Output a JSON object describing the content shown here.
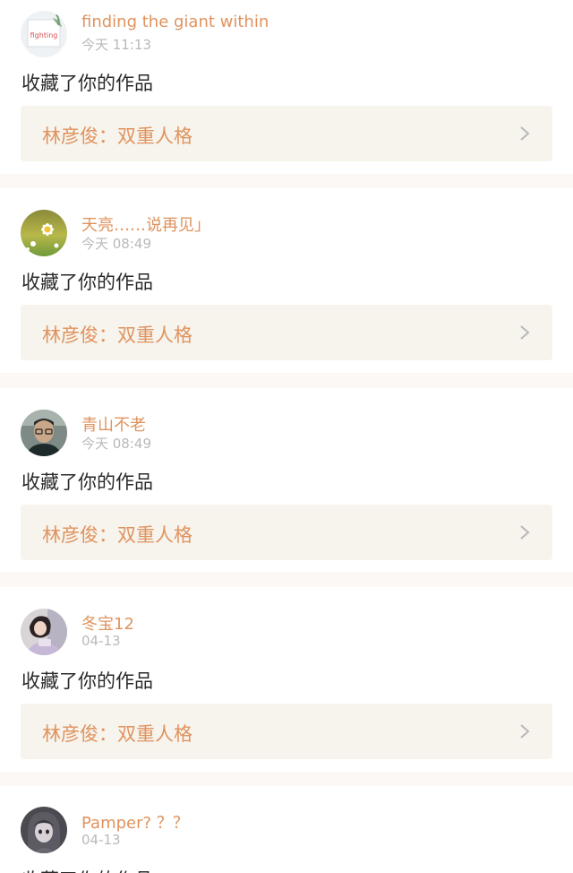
{
  "feed": [
    {
      "username": "finding the giant within",
      "time": "今天 11:13",
      "action": "收藏了你的作品",
      "work_title": "林彦俊：双重人格",
      "avatar_icon": "fighting-sticker-avatar-icon",
      "avatar_text": "fighting"
    },
    {
      "username": "天亮……说再见」",
      "time": "今天 08:49",
      "action": "收藏了你的作品",
      "work_title": "林彦俊：双重人格",
      "avatar_icon": "daisy-flower-avatar-icon"
    },
    {
      "username": "青山不老",
      "time": "今天 08:49",
      "action": "收藏了你的作品",
      "work_title": "林彦俊：双重人格",
      "avatar_icon": "man-with-glasses-avatar-icon"
    },
    {
      "username": "冬宝12",
      "time": "04-13",
      "action": "收藏了你的作品",
      "work_title": "林彦俊：双重人格",
      "avatar_icon": "woman-photo-avatar-icon"
    },
    {
      "username": "Pamper? ？？",
      "time": "04-13",
      "action": "收藏了你的作品",
      "avatar_icon": "anime-girl-avatar-icon"
    }
  ],
  "colors": {
    "username": "#e0935e",
    "time": "#b9b9b9",
    "action_text": "#2a2a2a",
    "work_card_bg": "#f6f4ed",
    "separator": "#fbf8f6"
  },
  "icons": {
    "chevron": "chevron-right-icon"
  }
}
